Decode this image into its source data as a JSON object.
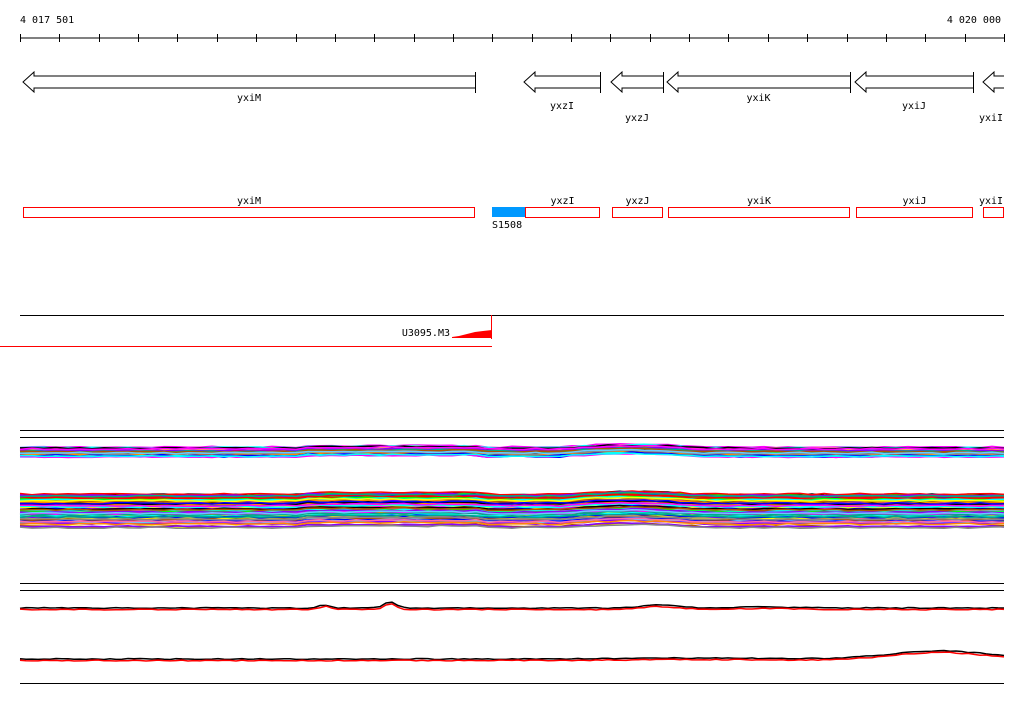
{
  "ruler": {
    "start_label": "4 017 501",
    "end_label": "4 020 000",
    "start": 4017501,
    "end": 4020000
  },
  "genes": [
    {
      "name": "yxiM",
      "strand": "-"
    },
    {
      "name": "yxzI",
      "strand": "-"
    },
    {
      "name": "yxzJ",
      "strand": "-"
    },
    {
      "name": "yxiK",
      "strand": "-"
    },
    {
      "name": "yxiJ",
      "strand": "-"
    },
    {
      "name": "yxiI",
      "strand": "-"
    }
  ],
  "features": [
    {
      "name": "yxiM",
      "color": "#ff0000"
    },
    {
      "name": "yxzI",
      "color": "#ff0000"
    },
    {
      "name": "yxzJ",
      "color": "#ff0000"
    },
    {
      "name": "yxiK",
      "color": "#ff0000"
    },
    {
      "name": "yxiJ",
      "color": "#ff0000"
    },
    {
      "name": "yxiI",
      "color": "#ff0000"
    }
  ],
  "segment": {
    "name": "S1508",
    "color": "#0099ff"
  },
  "transcript": {
    "name": "U3095.M3",
    "color": "#ff0000"
  }
}
